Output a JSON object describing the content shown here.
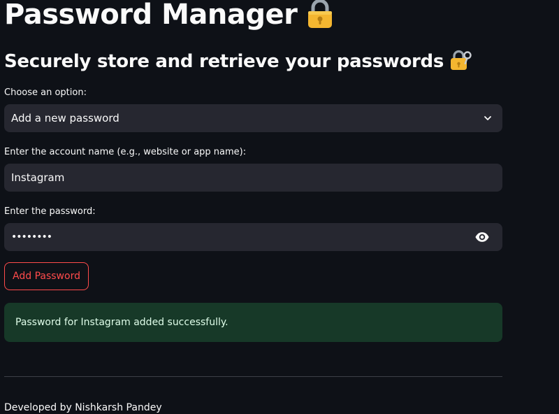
{
  "header": {
    "title": "Password Manager",
    "title_icon": "lock-icon",
    "subtitle": "Securely store and retrieve your passwords",
    "subtitle_icon": "lock-with-key-icon"
  },
  "form": {
    "option_label": "Choose an option:",
    "option_value": "Add a new password",
    "account_label": "Enter the account name (e.g., website or app name):",
    "account_value": "Instagram",
    "password_label": "Enter the password:",
    "password_value": "••••••••",
    "add_button_label": "Add Password"
  },
  "alert": {
    "message": "Password for Instagram added successfully."
  },
  "footer": {
    "text": "Developed by Nishkarsh Pandey"
  },
  "colors": {
    "background": "#0e1117",
    "input_bg": "#262730",
    "accent": "#ff4b4b",
    "success_bg": "#173928",
    "lock_gold": "#f4b630"
  }
}
